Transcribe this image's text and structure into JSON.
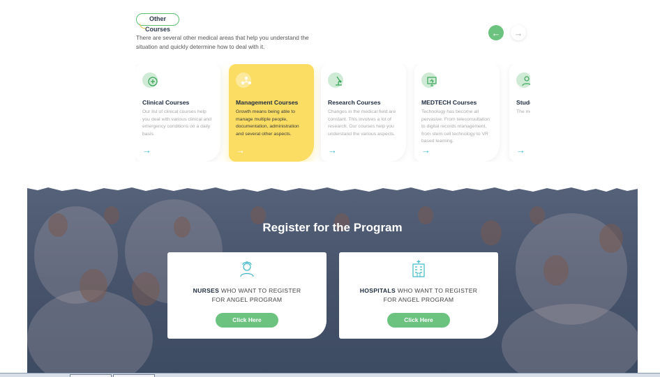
{
  "section": {
    "badge": "Other Courses",
    "intro": "There are several other medical areas that help you understand the situation and quickly determine how to deal with it.",
    "prev_icon": "←",
    "next_icon": "→"
  },
  "courses": [
    {
      "title": "Clinical Courses",
      "desc": "Our list of clinical courses help you deal with various clinical and emergency conditions on a daily basis.",
      "icon": "medical-plus-icon",
      "arrow": "→"
    },
    {
      "title": "Management Courses",
      "desc": "Growth means being able to manage multiple people, documentation, administration and several other aspects.",
      "icon": "network-icon",
      "arrow": "→"
    },
    {
      "title": "Research Courses",
      "desc": "Changes in the medical field are constant. This involves a lot of research. Our courses help you understand the various aspects.",
      "icon": "microscope-icon",
      "arrow": "→"
    },
    {
      "title": "MEDTECH Courses",
      "desc": "Technology has become all pervasive. From teleconsultation to digital records management, from stem cell technology to VR based learning.",
      "icon": "monitor-icon",
      "arrow": "→"
    },
    {
      "title": "Stude",
      "desc": "The me learnin updatin proces",
      "icon": "student-icon",
      "arrow": "→"
    }
  ],
  "colors": {
    "accent": "#6cc27f",
    "highlight": "#fbdd64",
    "arrow": "#3db7c8"
  },
  "register": {
    "title": "Register for the Program",
    "cards": [
      {
        "strong": "NURSES",
        "rest": " WHO WANT TO REGISTER",
        "line2": "FOR ANGEL PROGRAM",
        "button": "Click Here",
        "icon": "nurse-icon"
      },
      {
        "strong": "HOSPITALS",
        "rest": " WHO WANT TO REGISTER",
        "line2": "FOR ANGEL PROGRAM",
        "button": "Click Here",
        "icon": "hospital-icon"
      }
    ]
  }
}
